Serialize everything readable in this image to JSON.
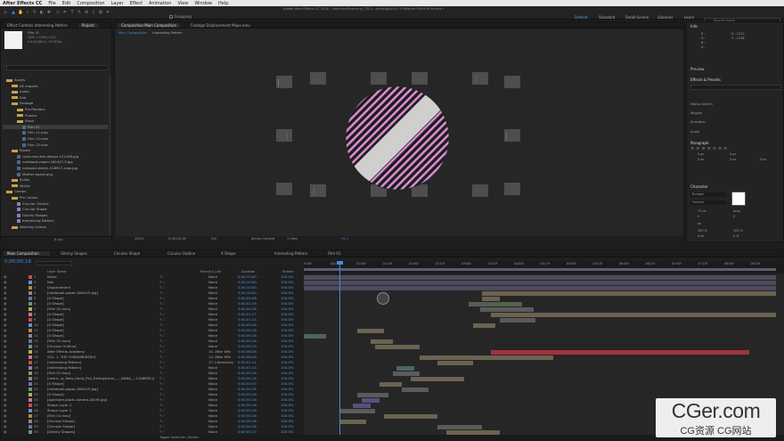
{
  "menubar": {
    "app_name": "After Effects CC",
    "items": [
      "File",
      "Edit",
      "Composition",
      "Layer",
      "Effect",
      "Animation",
      "View",
      "Window",
      "Help"
    ],
    "title": "Adobe After Effects CC 2018 - /Volumes/Samsung_T5/Cr...ecials/glitch-it-3 Polished Glitch Build.aep *"
  },
  "toolbar": {
    "snapping": "Snapping",
    "workspaces": [
      "Default",
      "Standard",
      "Small Screen",
      "Libraries",
      "Learn"
    ],
    "active_workspace": "Default",
    "search_placeholder": "Search Help"
  },
  "project_panel": {
    "tabs": [
      "Effect Controls Interesting Pattern",
      "Project"
    ],
    "preview_name": "Film 01",
    "preview_info": [
      "1000 x 1080 (1.00)",
      "Δ 0;00;06;22, 25.00 fps"
    ],
    "tree": [
      {
        "label": "Assets",
        "depth": 0,
        "kind": "folder"
      },
      {
        "label": "AE imports",
        "depth": 1,
        "kind": "folder"
      },
      {
        "label": "Audio",
        "depth": 1,
        "kind": "folder"
      },
      {
        "label": "Edit",
        "depth": 1,
        "kind": "folder"
      },
      {
        "label": "Footage",
        "depth": 1,
        "kind": "folder"
      },
      {
        "label": "Pre Renders",
        "depth": 2,
        "kind": "folder"
      },
      {
        "label": "Proxies",
        "depth": 2,
        "kind": "folder"
      },
      {
        "label": "Stock",
        "depth": 2,
        "kind": "folder"
      },
      {
        "label": "Film 01",
        "depth": 3,
        "kind": "file",
        "selected": true
      },
      {
        "label": "Film 11.mov",
        "depth": 3,
        "kind": "file"
      },
      {
        "label": "Film 12.mov",
        "depth": 3,
        "kind": "file"
      },
      {
        "label": "Film 13.mov",
        "depth": 3,
        "kind": "file"
      },
      {
        "label": "Raster",
        "depth": 1,
        "kind": "folder"
      },
      {
        "label": "color-rose-tee-design-121438.jpg",
        "depth": 2,
        "kind": "file"
      },
      {
        "label": "notebook-paper-180447-3.jpg",
        "depth": 2,
        "kind": "file"
      },
      {
        "label": "notepad-sketch-228917-crop.jpg",
        "depth": 2,
        "kind": "file"
      },
      {
        "label": "Mother board.png",
        "depth": 2,
        "kind": "file"
      },
      {
        "label": "Solids",
        "depth": 1,
        "kind": "folder"
      },
      {
        "label": "Vector",
        "depth": 1,
        "kind": "folder"
      },
      {
        "label": "Comps",
        "depth": 0,
        "kind": "folder"
      },
      {
        "label": "Pre Comps",
        "depth": 1,
        "kind": "folder"
      },
      {
        "label": "Circular Outline",
        "depth": 2,
        "kind": "comp"
      },
      {
        "label": "Circular Shape",
        "depth": 2,
        "kind": "comp"
      },
      {
        "label": "Glitchy Shapes",
        "depth": 2,
        "kind": "comp"
      },
      {
        "label": "Interesting Pattern",
        "depth": 2,
        "kind": "comp"
      },
      {
        "label": "Working Comps",
        "depth": 1,
        "kind": "folder"
      }
    ],
    "footer": "8 bpc"
  },
  "viewer": {
    "tabs": [
      "Composition Main Composition",
      "Footage Displacement Maps.mov"
    ],
    "subtabs": [
      "Main Composition",
      "Interesting Pattern"
    ],
    "zoom": "100%",
    "timecode": "0;00;00;18",
    "resolution": "Full",
    "camera": "Active Camera",
    "views": "1 View",
    "exposure": "+0.0"
  },
  "right_panels": {
    "info": {
      "title": "Info",
      "r": "R :",
      "g": "G :",
      "b": "B :",
      "a": "A :",
      "x": "X : 1312",
      "y": "Y : 1108"
    },
    "preview": "Preview",
    "effects_presets": "Effects & Presets",
    "effects_search_placeholder": "",
    "presets": [
      "Motion Sketch",
      "Wiggler",
      "Smoother",
      "Audio"
    ],
    "paragraph": {
      "title": "Paragraph",
      "values": [
        "0 px",
        "0 px",
        "0 px",
        "0 px",
        "0 px"
      ]
    },
    "character": {
      "title": "Character",
      "font": "Bungee",
      "style": "Hairline",
      "size": "75 px",
      "leading": "Auto",
      "kerning": "0",
      "tracking": "0",
      "units": "px",
      "vscale": "100 %",
      "hscale": "100 %",
      "baseline": "0 px",
      "tsume": "0 %"
    }
  },
  "timeline": {
    "tabs": [
      "Main Composition",
      "Glitchy Shapes",
      "Circular Shape",
      "Circular Outline",
      "X Shape",
      "Interesting Pattern",
      "Film 01"
    ],
    "timecode": "0;00;00;18",
    "columns": [
      "Layer Name",
      "Parent & Link",
      "Duration",
      "Stretch"
    ],
    "ruler_labels": [
      "0:00f",
      "00:15f",
      "01:00f",
      "01:15f",
      "02:00f",
      "02:15f",
      "03:00f",
      "03:15f",
      "04:00f",
      "04:15f",
      "05:00f",
      "05:15f",
      "06:00f",
      "06:15f",
      "07:00f",
      "07:15f",
      "08:00f",
      "08:15f"
    ],
    "layers": [
      {
        "num": "1",
        "name": "Noise",
        "parent": "None",
        "dur": "0;00;10;00",
        "stretch": "100.0%"
      },
      {
        "num": "2",
        "name": "Null",
        "parent": "None",
        "dur": "0;00;10;00",
        "stretch": "100.0%"
      },
      {
        "num": "3",
        "name": "Displacement",
        "parent": "None",
        "dur": "0;00;10;00",
        "stretch": "100.0%"
      },
      {
        "num": "4",
        "name": "[notebook-paper-180447l.jpg]",
        "parent": "None",
        "dur": "0;00;10;00",
        "stretch": "100.0%"
      },
      {
        "num": "5",
        "name": "[X Shape]",
        "parent": "None",
        "dur": "0;00;00;08",
        "stretch": "100.0%"
      },
      {
        "num": "6",
        "name": "[X Shape]",
        "parent": "None",
        "dur": "0;00;01;19",
        "stretch": "100.0%"
      },
      {
        "num": "7",
        "name": "[Film 01.mov]",
        "parent": "None",
        "dur": "0;00;00;16",
        "stretch": "100.0%"
      },
      {
        "num": "8",
        "name": "[X Shape]",
        "parent": "None",
        "dur": "0;00;03;17",
        "stretch": "100.0%"
      },
      {
        "num": "9",
        "name": "[X Shape]",
        "parent": "None",
        "dur": "0;00;01;14",
        "stretch": "100.0%"
      },
      {
        "num": "10",
        "name": "[X Shape]",
        "parent": "None",
        "dur": "0;00;00;08",
        "stretch": "100.0%"
      },
      {
        "num": "11",
        "name": "[X Shape]",
        "parent": "None",
        "dur": "0;00;00;16",
        "stretch": "100.0%"
      },
      {
        "num": "12",
        "name": "[X Shape]",
        "parent": "None",
        "dur": "0;00;00;18",
        "stretch": "100.0%"
      },
      {
        "num": "13",
        "name": "[Film 01.mov]",
        "parent": "None",
        "dur": "0;00;00;16",
        "stretch": "100.0%"
      },
      {
        "num": "14",
        "name": "[Circular Outline]",
        "parent": "None",
        "dur": "0;00;00;19",
        "stretch": "100.0%"
      },
      {
        "num": "15",
        "name": "After Effects Academy",
        "parent": "14. After Effe",
        "dur": "0;00;06;08",
        "stretch": "100.0%"
      },
      {
        "num": "16",
        "name": "VOL. 1: THE FUNDAMENTALS",
        "parent": "14. After Effe",
        "dur": "0;00;06;08",
        "stretch": "100.0%"
      },
      {
        "num": "17",
        "name": "[Interesting Pattern]",
        "parent": "17. Interesting",
        "dur": "0;00;01;11",
        "stretch": "100.0%"
      },
      {
        "num": "18",
        "name": "[Interesting Pattern]",
        "parent": "None",
        "dur": "0;00;01;10",
        "stretch": "100.0%"
      },
      {
        "num": "19",
        "name": "[Film 01.mov]",
        "parent": "None",
        "dur": "0;00;00;16",
        "stretch": "100.0%"
      },
      {
        "num": "20",
        "name": "[Learn...p_Tools_Hand_Fire_Extinguisher_..._NANA_...1146655.jpg]",
        "parent": "None",
        "dur": "0;00;00;16",
        "stretch": "100.0%"
      },
      {
        "num": "21",
        "name": "[X Shape]",
        "parent": "None",
        "dur": "0;00;00;07",
        "stretch": "100.0%"
      },
      {
        "num": "22",
        "name": "[notebook-paper-180447l.jpg]",
        "parent": "None",
        "dur": "0;00;00;16",
        "stretch": "100.0%"
      },
      {
        "num": "23",
        "name": "[X Shape]",
        "parent": "None",
        "dur": "0;00;00;18",
        "stretch": "100.0%"
      },
      {
        "num": "24",
        "name": "[apertaire-black-camera-400HI.jpg]",
        "parent": "None",
        "dur": "0;00;00;16",
        "stretch": "100.0%"
      },
      {
        "num": "25",
        "name": "Shape Layer 2",
        "parent": "None",
        "dur": "0;00;00;16",
        "stretch": "100.0%"
      },
      {
        "num": "26",
        "name": "Shape Layer 1",
        "parent": "None",
        "dur": "0;00;00;16",
        "stretch": "100.0%"
      },
      {
        "num": "27",
        "name": "[Film 01.mov]",
        "parent": "None",
        "dur": "0;00;00;16",
        "stretch": "100.0%"
      },
      {
        "num": "28",
        "name": "[Circular Shape]",
        "parent": "None",
        "dur": "0;00;00;16",
        "stretch": "100.0%"
      },
      {
        "num": "29",
        "name": "[Circular Shape]",
        "parent": "None",
        "dur": "0;00;00;16",
        "stretch": "100.0%"
      },
      {
        "num": "30",
        "name": "[Glitchy Shapes]",
        "parent": "None",
        "dur": "0;00;00;17",
        "stretch": "100.0%"
      }
    ],
    "footer": "Toggle Switches / Modes",
    "bar_colors": {
      "light": "#4e4a5c",
      "tan": "#6b6350",
      "green": "#55604f",
      "red": "#a33240",
      "teal": "#4b6466",
      "purple": "#58517d",
      "gray": "#5b5b5b"
    }
  },
  "watermark": {
    "big": "CGer.com",
    "small": "CG资源 CG网站"
  },
  "colors": {
    "accent": "#3d8ed9",
    "stripe_pink": "#d88ad0",
    "panel": "#232323"
  }
}
